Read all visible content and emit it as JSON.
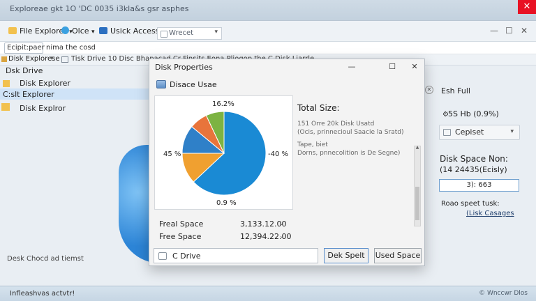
{
  "window": {
    "title": "Exploreae gkt 1O 'DC 0035 i3kla&s gsr asphes",
    "close_glyph": "✕"
  },
  "tabs": [
    {
      "label": "File Explorer",
      "chevron": "▾"
    },
    {
      "label": "Olce",
      "chevron": "▾"
    },
    {
      "label": "Usick Access"
    }
  ],
  "tab_search": {
    "value": "Wrecet"
  },
  "tabbar_right": {
    "minimize": "—",
    "maximize": "☐",
    "close": "✕"
  },
  "address": {
    "value": "Ecipit:paer",
    "text": "nima the cosd"
  },
  "breadcrumb": {
    "root": "Disk Explorese",
    "path": "Tisk Drive 10 Disc Bhapacad Cr Finsits Eona Pljogop the C Disk Liarrle"
  },
  "nav": {
    "header": "Dsk Drive",
    "items": [
      "Disk Explorer",
      "C:slt Explorer",
      "Disk Explror"
    ]
  },
  "right_panel": {
    "title": "Esh Full",
    "stat": "5S Hb (0.9%)",
    "combo": "Cepiset",
    "label": "Disk Space Non:",
    "value": "(14 24435(Ecisly)",
    "field": "3): 663",
    "caption": "Roao speet tusk:",
    "link": "(Lisk Casages"
  },
  "dialog": {
    "title": "Disk Properties",
    "controls": {
      "minimize": "—",
      "maximize": "☐",
      "close": "✕"
    },
    "header": "Disace Usae",
    "info_title": "Total Size:",
    "info_lines": [
      "151 Orre 20k Disk Usatd",
      "(Ocis, prinnecioul Saacie la Sratd)",
      "Tape, biet",
      "Dorns, pnnecolition is De Segne)"
    ],
    "free_space": {
      "label": "Freal Space",
      "value": "3,133.12.00"
    },
    "free_space2": {
      "label": "Free Space",
      "value": "12,394.22.00"
    },
    "drive": "C Drive",
    "btn_primary": "Dek Spelt",
    "btn_secondary": "Used Space"
  },
  "chart_data": {
    "type": "pie",
    "labels_shown": [
      "16.2%",
      "45 %",
      "-40 %",
      "0.9 %"
    ],
    "slices": [
      {
        "value": 63,
        "color": "#1a8ad4"
      },
      {
        "value": 12,
        "color": "#f0a030"
      },
      {
        "value": 11,
        "color": "#2f80c8"
      },
      {
        "value": 7,
        "color": "#e8743b"
      },
      {
        "value": 7,
        "color": "#7cb342"
      }
    ]
  },
  "status": {
    "text": "Desk Chocd ad tiemst"
  },
  "taskbar": {
    "left": "Infleashvas actvtr!",
    "right": "© Wnccwr Dlos"
  }
}
